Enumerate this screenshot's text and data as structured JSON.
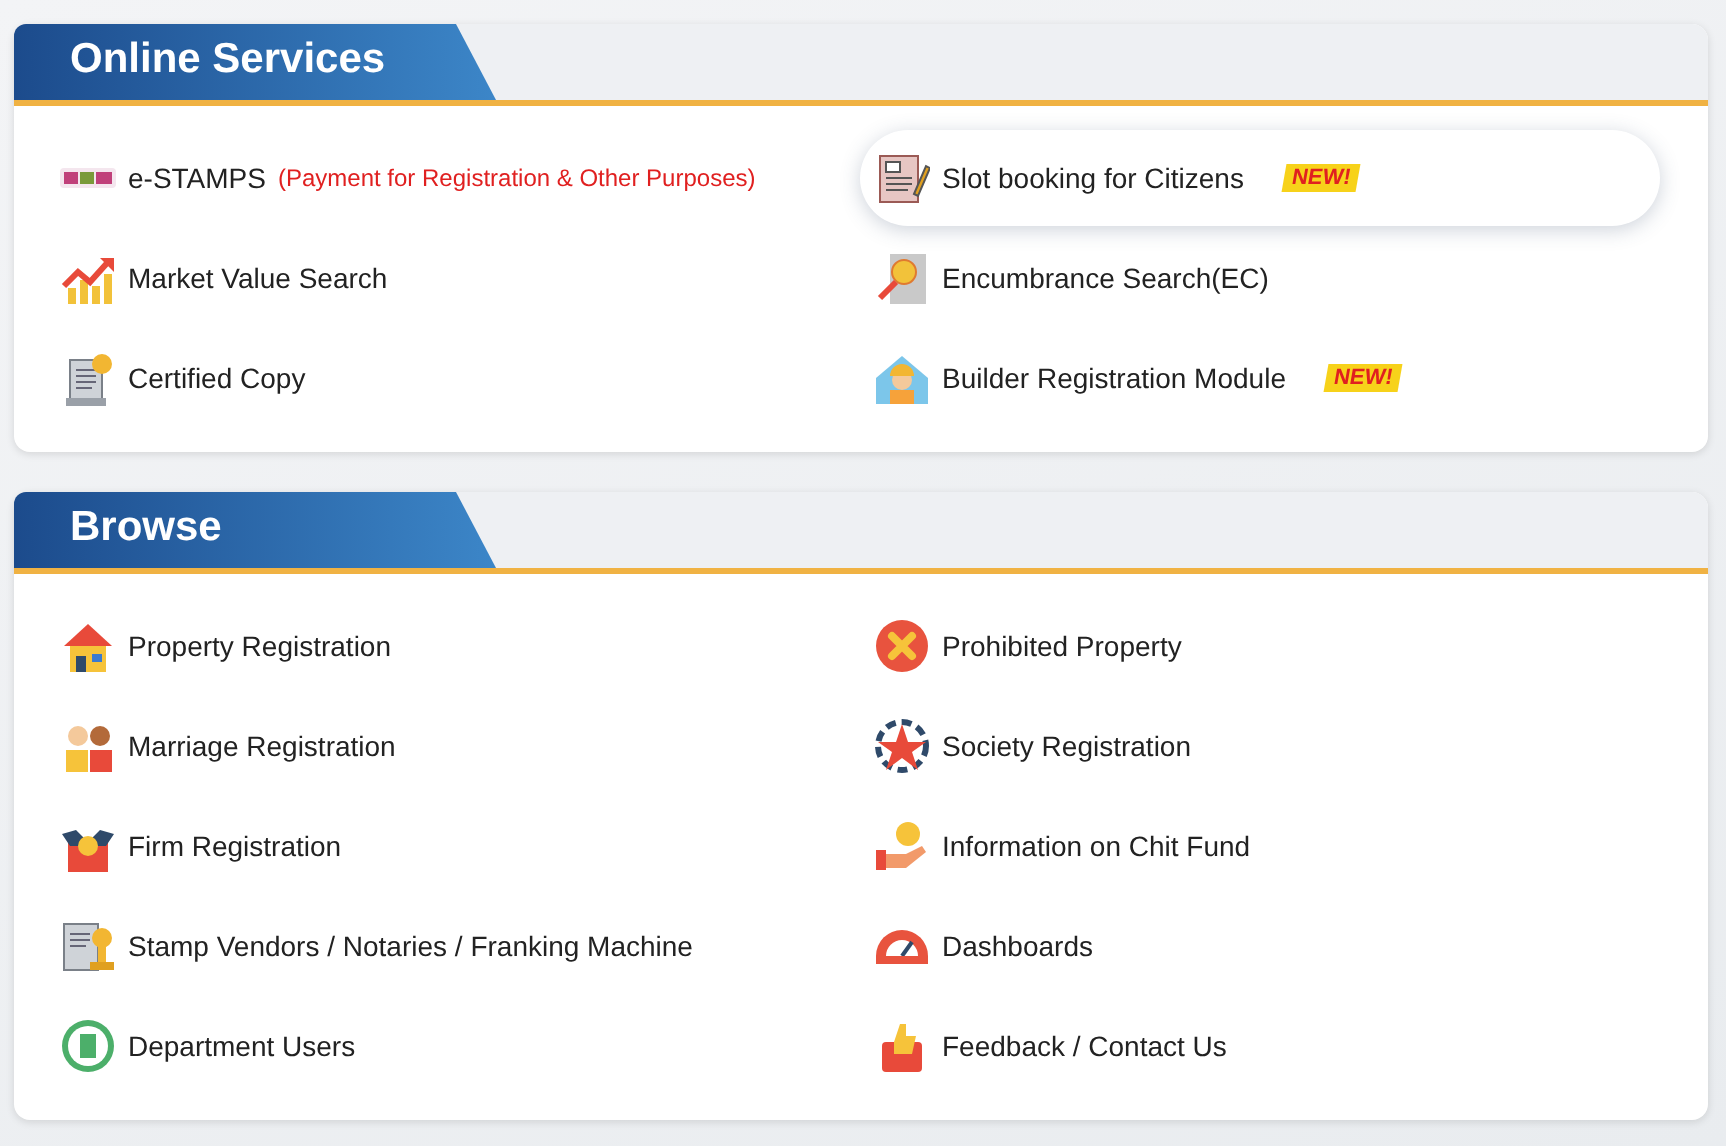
{
  "sections": [
    {
      "title": "Online Services",
      "items": [
        {
          "label": "e-STAMPS",
          "note": "(Payment for Registration & Other Purposes)",
          "selected": false
        },
        {
          "label": "Slot booking for Citizens",
          "badge": "NEW!",
          "selected": true
        },
        {
          "label": "Market Value Search",
          "selected": false
        },
        {
          "label": "Encumbrance Search(EC)",
          "selected": false
        },
        {
          "label": "Certified Copy",
          "selected": false
        },
        {
          "label": "Builder Registration Module",
          "badge": "NEW!",
          "selected": false
        }
      ]
    },
    {
      "title": "Browse",
      "items": [
        {
          "label": "Property Registration",
          "selected": false
        },
        {
          "label": "Prohibited Property",
          "selected": false
        },
        {
          "label": "Marriage Registration",
          "selected": false
        },
        {
          "label": "Society Registration",
          "selected": false
        },
        {
          "label": "Firm Registration",
          "selected": false
        },
        {
          "label": "Information on Chit Fund",
          "selected": false
        },
        {
          "label": "Stamp Vendors / Notaries / Franking Machine",
          "selected": false
        },
        {
          "label": "Dashboards",
          "selected": false
        },
        {
          "label": "Department Users",
          "selected": false
        },
        {
          "label": "Feedback / Contact Us",
          "selected": false
        }
      ]
    }
  ]
}
